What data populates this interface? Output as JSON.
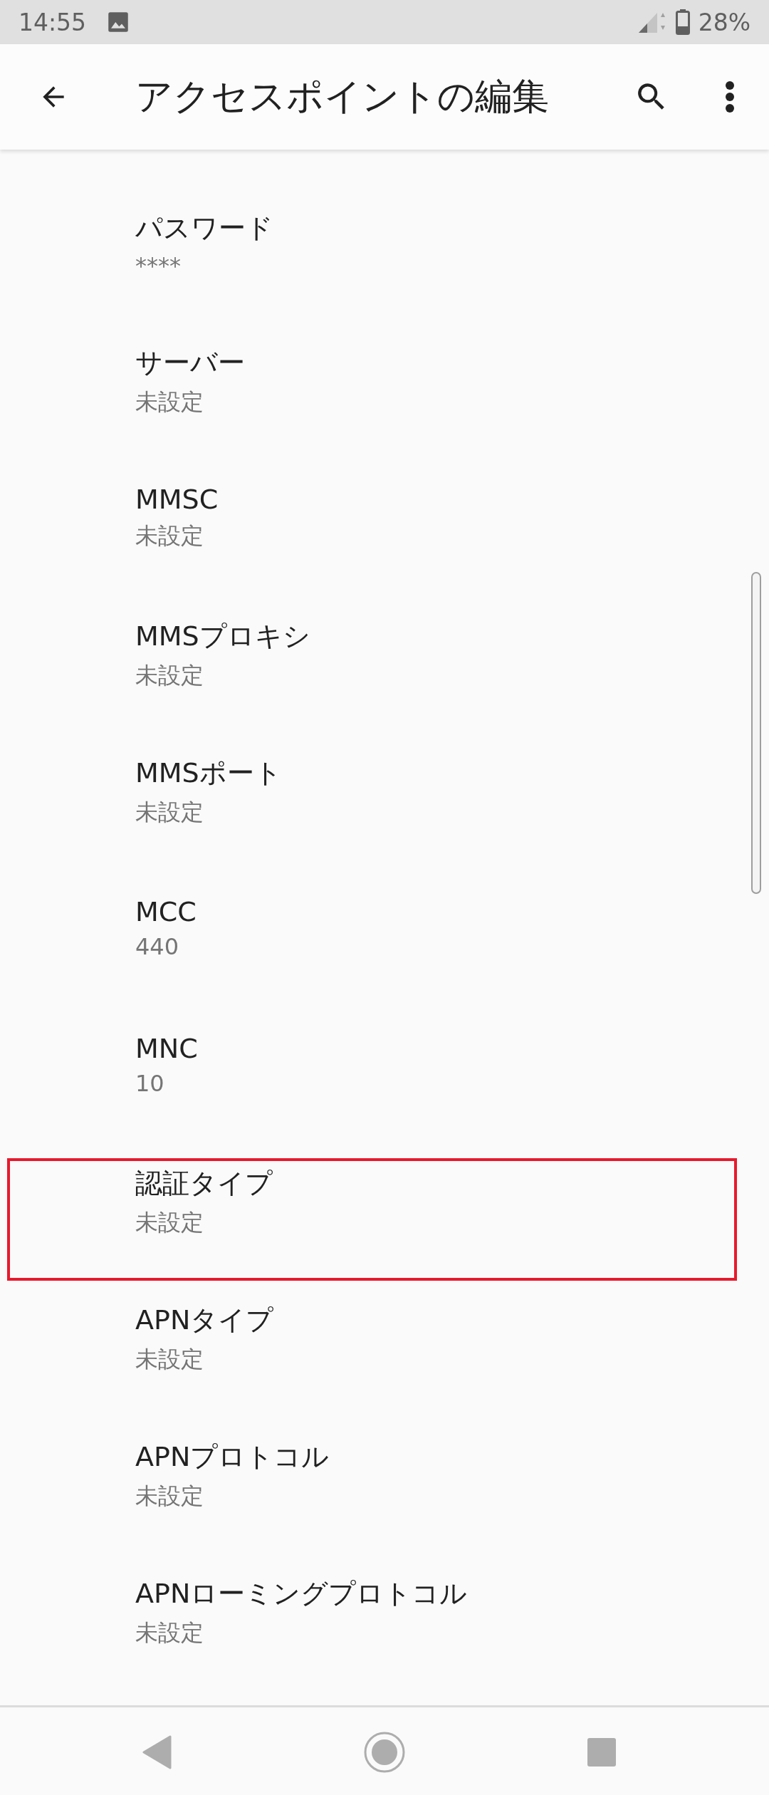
{
  "status_bar": {
    "time": "14:55",
    "battery": "28%"
  },
  "app_bar": {
    "title": "アクセスポイントの編集"
  },
  "items": [
    {
      "title": "パスワード",
      "value": "****",
      "highlighted": false
    },
    {
      "title": "サーバー",
      "value": "未設定",
      "highlighted": false
    },
    {
      "title": "MMSC",
      "value": "未設定",
      "highlighted": false
    },
    {
      "title": "MMSプロキシ",
      "value": "未設定",
      "highlighted": false
    },
    {
      "title": "MMSポート",
      "value": "未設定",
      "highlighted": false
    },
    {
      "title": "MCC",
      "value": "440",
      "highlighted": false
    },
    {
      "title": "MNC",
      "value": "10",
      "highlighted": false
    },
    {
      "title": "認証タイプ",
      "value": "未設定",
      "highlighted": true
    },
    {
      "title": "APNタイプ",
      "value": "未設定",
      "highlighted": false
    },
    {
      "title": "APNプロトコル",
      "value": "未設定",
      "highlighted": false
    },
    {
      "title": "APNローミングプロトコル",
      "value": "未設定",
      "highlighted": false
    }
  ]
}
